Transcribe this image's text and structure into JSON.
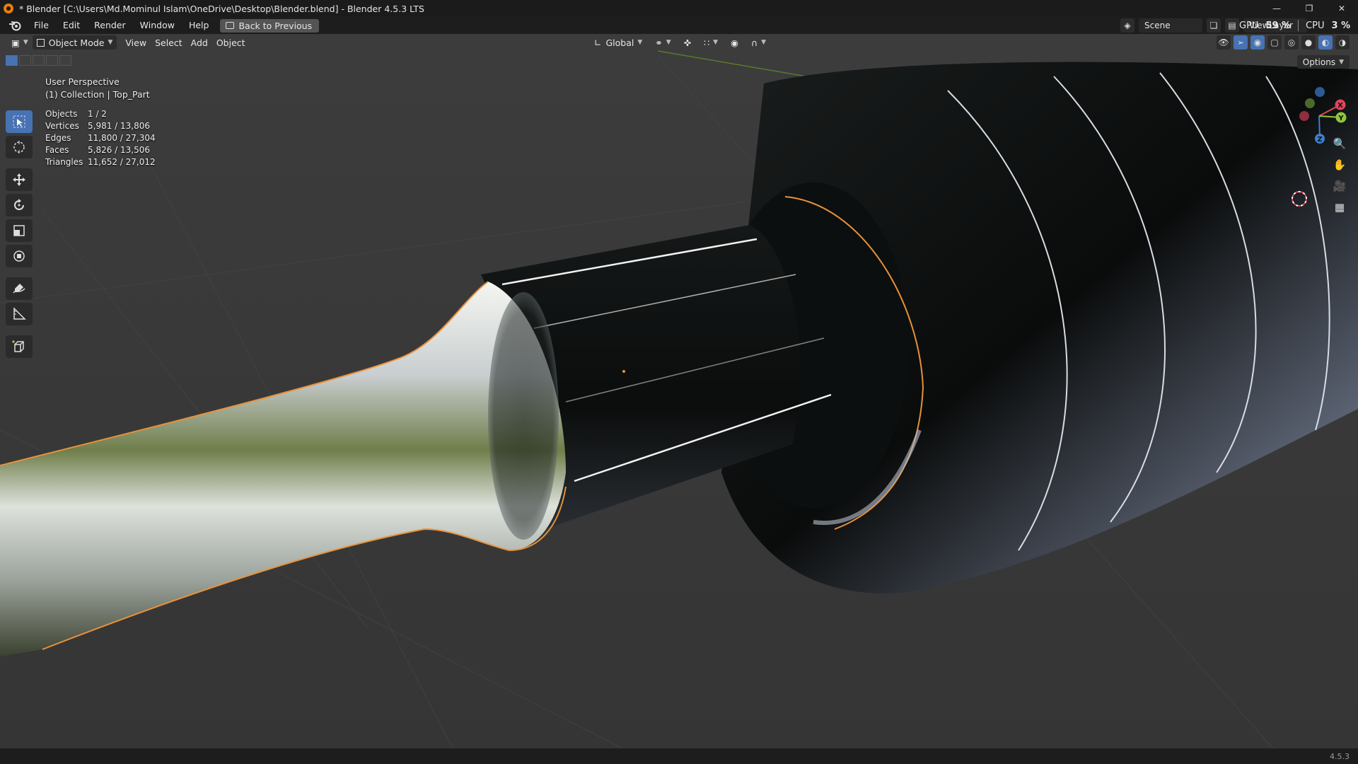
{
  "window": {
    "title": "* Blender [C:\\Users\\Md.Mominul Islam\\OneDrive\\Desktop\\Blender.blend] - Blender 4.5.3 LTS"
  },
  "menu": {
    "items": [
      "File",
      "Edit",
      "Render",
      "Window",
      "Help"
    ],
    "back_button": "Back to Previous"
  },
  "scene": {
    "name": "Scene",
    "view_layer": "ViewLayer"
  },
  "perf": {
    "gpu_label": "GPU",
    "gpu_value": "59 %",
    "cpu_label": "CPU",
    "cpu_value": "3 %"
  },
  "viewport_header": {
    "mode": "Object Mode",
    "menus": [
      "View",
      "Select",
      "Add",
      "Object"
    ],
    "orientation": "Global",
    "options": "Options"
  },
  "overlay": {
    "perspective": "User Perspective",
    "collection": "(1) Collection | Top_Part",
    "stats": [
      {
        "label": "Objects",
        "value": "1 / 2"
      },
      {
        "label": "Vertices",
        "value": "5,981 / 13,806"
      },
      {
        "label": "Edges",
        "value": "11,800 / 27,304"
      },
      {
        "label": "Faces",
        "value": "5,826 / 13,506"
      },
      {
        "label": "Triangles",
        "value": "11,652 / 27,012"
      }
    ]
  },
  "gizmo": {
    "x": "X",
    "y": "Y",
    "z": "Z"
  },
  "version": "4.5.3",
  "colors": {
    "accent": "#4772b3",
    "selection_outline": "#e8913a",
    "axis_x": "#e0455c",
    "axis_y": "#8ec63f",
    "axis_z": "#3f7fd0"
  }
}
